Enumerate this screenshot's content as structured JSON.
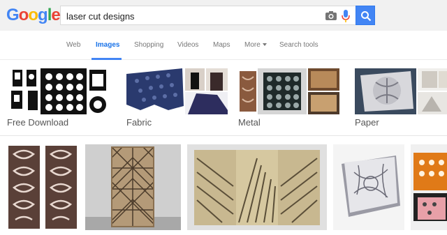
{
  "logo": {
    "letters": [
      "G",
      "o",
      "o",
      "g",
      "l",
      "e"
    ],
    "colors": [
      "#4285f4",
      "#ea4335",
      "#fbbc05",
      "#4285f4",
      "#34a853",
      "#ea4335"
    ]
  },
  "search": {
    "query": "laser cut designs",
    "button_icon": "search-icon"
  },
  "tabs": [
    {
      "label": "Web"
    },
    {
      "label": "Images",
      "active": true
    },
    {
      "label": "Shopping"
    },
    {
      "label": "Videos"
    },
    {
      "label": "Maps"
    },
    {
      "label": "More"
    },
    {
      "label": "Search tools"
    }
  ],
  "related_searches": [
    {
      "label": "Free Download"
    },
    {
      "label": "Fabric"
    },
    {
      "label": "Metal"
    },
    {
      "label": "Paper"
    }
  ],
  "results": [
    {
      "description": "brown laser cut panels"
    },
    {
      "description": "geometric laser cut screen"
    },
    {
      "description": "gold laser cut panels"
    },
    {
      "description": "white paper laser cut invitation"
    },
    {
      "description": "orange laser cut cards"
    }
  ],
  "colors": {
    "accent": "#4285f4",
    "active_tab": "#1a73e8",
    "topbar": "#f1f1f1"
  }
}
